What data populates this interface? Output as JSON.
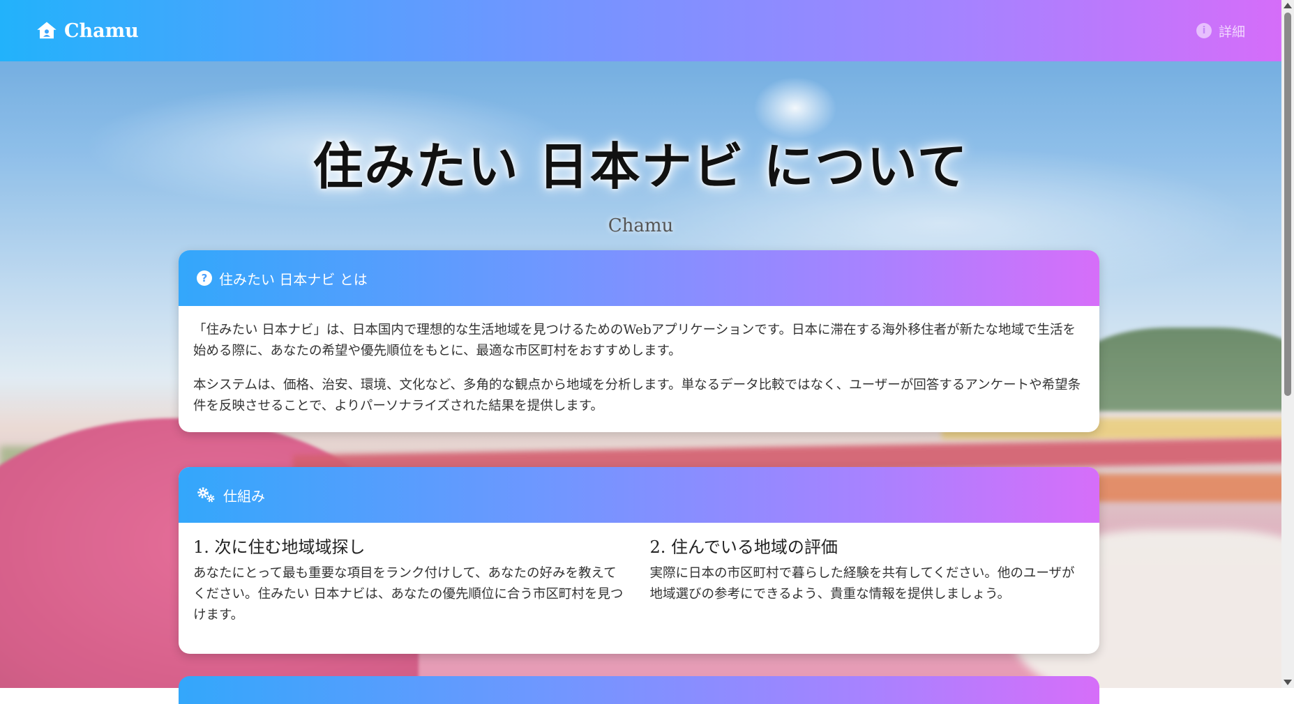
{
  "navbar": {
    "brand": "Chamu",
    "detail_label": "詳細",
    "brand_icon": "home-icon",
    "detail_icon": "info-icon"
  },
  "hero": {
    "title": "住みたい 日本ナビ について",
    "subtitle": "Chamu"
  },
  "about_card": {
    "header_icon": "question-circle-icon",
    "header": "住みたい 日本ナビ とは",
    "paragraphs": [
      "「住みたい 日本ナビ」は、日本国内で理想的な生活地域を見つけるためのWebアプリケーションです。日本に滞在する海外移住者が新たな地域で生活を始める際に、あなたの希望や優先順位をもとに、最適な市区町村をおすすめします。",
      "本システムは、価格、治安、環境、文化など、多角的な観点から地域を分析します。単なるデータ比較ではなく、ユーザーが回答するアンケートや希望条件を反映させることで、よりパーソナライズされた結果を提供します。"
    ]
  },
  "how_card": {
    "header_icon": "cogs-icon",
    "header": "仕組み",
    "columns": [
      {
        "title": "1. 次に住む地域域探し",
        "text": "あなたにとって最も重要な項目をランク付けして、あなたの好みを教えてください。住みたい 日本ナビは、あなたの優先順位に合う市区町村を見つけます。"
      },
      {
        "title": "2. 住んでいる地域の評価",
        "text": "実際に日本の市区町村で暮らした経験を共有してください。他のユーザが地域選びの参考にできるよう、貴重な情報を提供しましょう。"
      }
    ]
  },
  "colors": {
    "gradient_start": "#22b2fb",
    "gradient_mid": "#a583ff",
    "gradient_end": "#d56df9"
  }
}
